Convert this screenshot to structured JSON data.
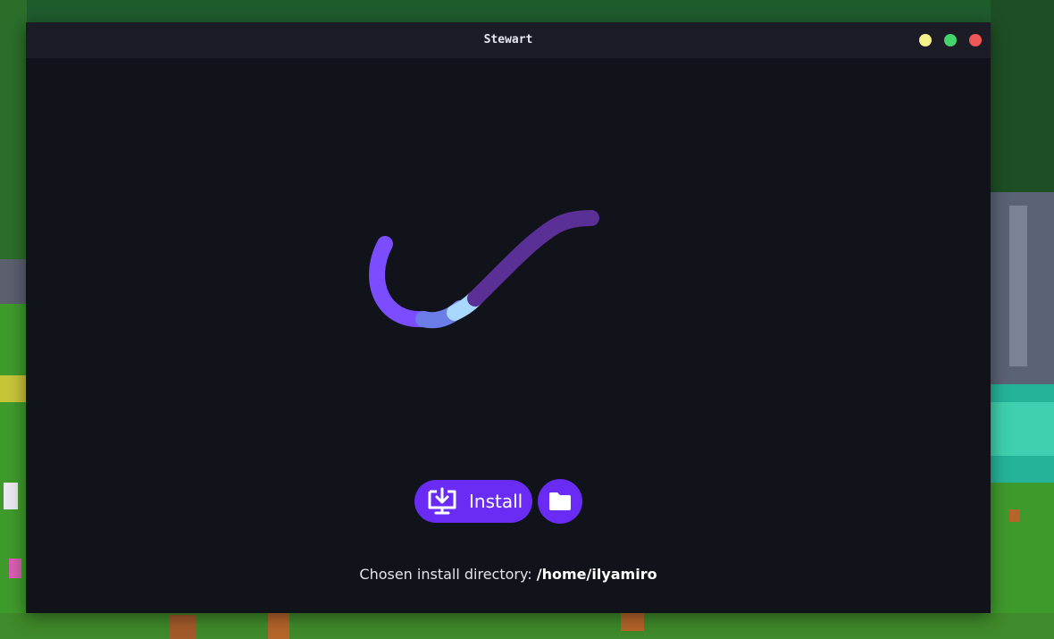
{
  "window": {
    "title": "Stewart",
    "controls": {
      "minimize_color": "#f4f08a",
      "maximize_color": "#45d46a",
      "close_color": "#f25757"
    }
  },
  "spinner": {
    "icon": "loading-spinner",
    "colors": [
      "#7c4dff",
      "#6a7de8",
      "#a9d8ff",
      "#5a2f96"
    ]
  },
  "actions": {
    "install_label": "Install",
    "install_icon": "download-to-screen-icon",
    "folder_icon": "folder-icon",
    "accent": "#6a2cf5"
  },
  "install_directory": {
    "prefix": "Chosen install directory: ",
    "path": "/home/ilyamiro"
  }
}
